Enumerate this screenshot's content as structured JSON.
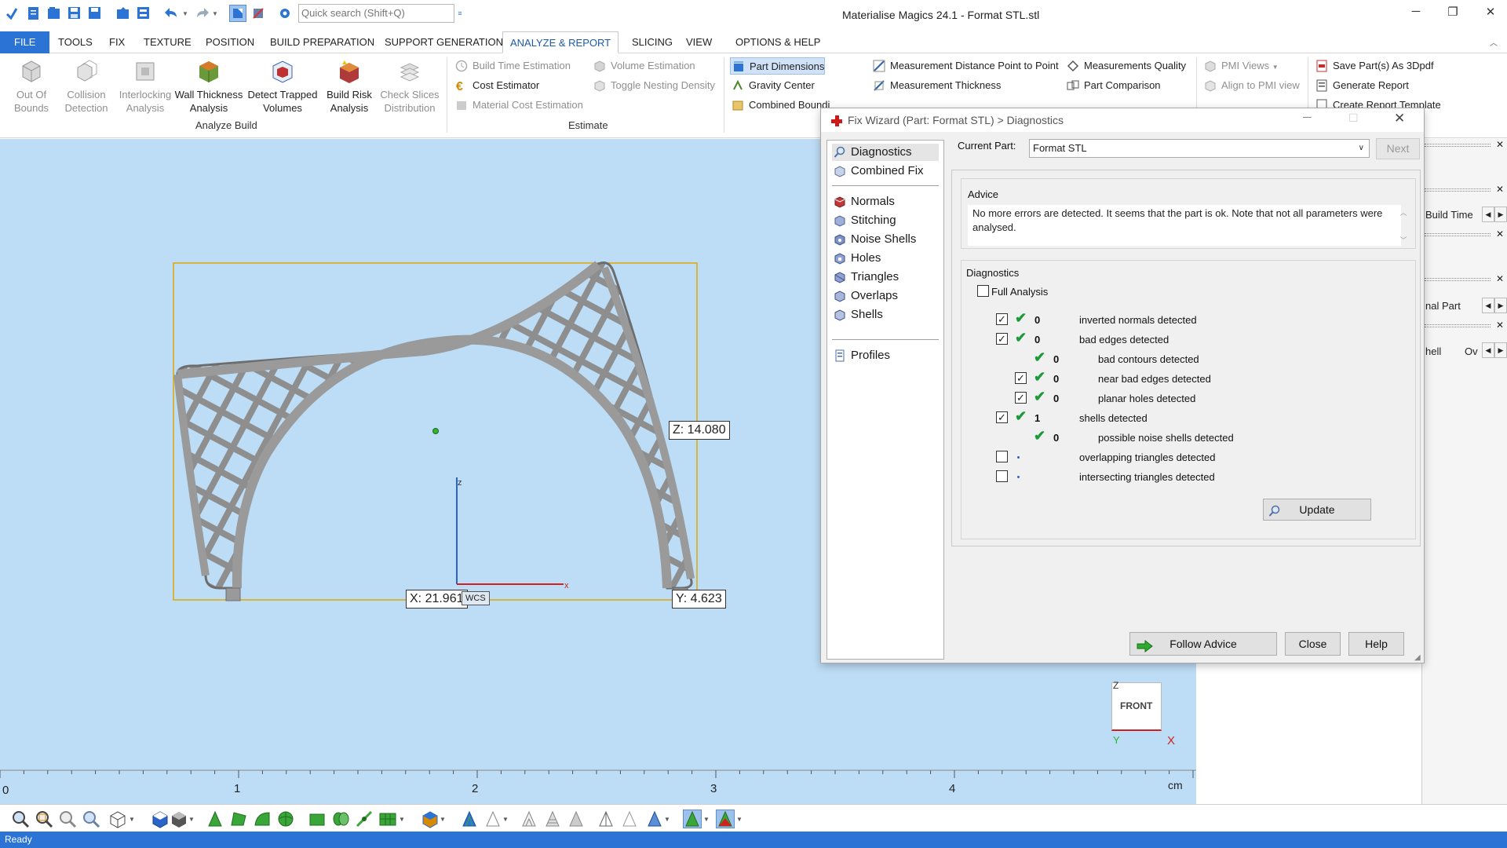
{
  "app": {
    "title": "Materialise Magics 24.1 - Format STL.stl",
    "search_placeholder": "Quick search (Shift+Q)"
  },
  "menu": {
    "items": [
      "FILE",
      "TOOLS",
      "FIX",
      "TEXTURE",
      "POSITION",
      "BUILD PREPARATION",
      "SUPPORT GENERATION",
      "ANALYZE & REPORT",
      "SLICING",
      "VIEW",
      "OPTIONS & HELP"
    ],
    "active": "ANALYZE & REPORT"
  },
  "ribbon": {
    "analyze_build": {
      "group_label": "Analyze Build",
      "out_of_bounds": [
        "Out Of",
        "Bounds"
      ],
      "collision": [
        "Collision",
        "Detection"
      ],
      "interlocking": [
        "Interlocking",
        "Analysis"
      ],
      "wall_thickness": [
        "Wall Thickness",
        "Analysis"
      ],
      "trapped": [
        "Detect Trapped",
        "Volumes"
      ],
      "build_risk": [
        "Build Risk",
        "Analysis"
      ],
      "check_slices": [
        "Check Slices",
        "Distribution"
      ]
    },
    "estimate": {
      "group_label": "Estimate",
      "build_time": "Build Time Estimation",
      "cost": "Cost Estimator",
      "material_cost": "Material Cost Estimation",
      "volume": "Volume Estimation",
      "nesting": "Toggle Nesting Density"
    },
    "measure": {
      "part_dimensions": "Part Dimensions",
      "gravity_center": "Gravity Center",
      "combined_bounding": "Combined Bounding Box",
      "distance_point": "Measurement Distance Point to Point",
      "thickness": "Measurement Thickness",
      "quality": "Measurements Quality",
      "comparison": "Part Comparison"
    },
    "pmi": {
      "pmi_views": "PMI Views",
      "align_pmi": "Align to PMI view"
    },
    "report": {
      "save_3dpdf": "Save Part(s) As 3Dpdf",
      "generate_report": "Generate Report",
      "create_template": "Create Report Template"
    }
  },
  "viewport": {
    "dim_z": "Z: 14.080",
    "dim_x": "X: 21.961",
    "dim_y": "Y: 4.623",
    "wcs": "WCS",
    "axis_z": "z",
    "axis_x": "x",
    "cube_label": "FRONT",
    "cube_z": "Z",
    "cube_y": "Y",
    "cube_x": "X",
    "ruler_ticks": [
      "0",
      "1",
      "2",
      "3",
      "4"
    ],
    "ruler_unit": "cm"
  },
  "right_panel": {
    "build_time": "Build Time",
    "original_part": "nal Part",
    "shell": "hell",
    "ov": "Ov"
  },
  "dialog": {
    "title": "Fix Wizard (Part: Format STL) > Diagnostics",
    "nav": {
      "diagnostics": "Diagnostics",
      "combined_fix": "Combined Fix",
      "normals": "Normals",
      "stitching": "Stitching",
      "noise_shells": "Noise Shells",
      "holes": "Holes",
      "triangles": "Triangles",
      "overlaps": "Overlaps",
      "shells": "Shells",
      "profiles": "Profiles"
    },
    "current_part_label": "Current Part:",
    "current_part_value": "Format STL",
    "next_button": "Next",
    "advice_title": "Advice",
    "advice_text": "No more errors are detected. It seems that the part is ok. Note that not all parameters were analysed.",
    "diagnostics_title": "Diagnostics",
    "full_analysis": "Full Analysis",
    "rows": [
      {
        "count": "0",
        "label": "inverted normals detected"
      },
      {
        "count": "0",
        "label": "bad edges detected"
      },
      {
        "count": "0",
        "label": "bad contours detected"
      },
      {
        "count": "0",
        "label": "near bad edges detected"
      },
      {
        "count": "0",
        "label": "planar holes detected"
      },
      {
        "count": "1",
        "label": "shells detected"
      },
      {
        "count": "0",
        "label": "possible noise shells detected"
      },
      {
        "count": "",
        "label": "overlapping triangles detected"
      },
      {
        "count": "",
        "label": "intersecting triangles detected"
      }
    ],
    "update_button": "Update",
    "follow_advice_button": "Follow Advice",
    "close_button": "Close",
    "help_button": "Help"
  },
  "status": {
    "text": "Ready"
  },
  "colors": {
    "accent": "#2b74d6",
    "viewport_bg": "#bdddf6",
    "part_gray": "#9a9a9a",
    "bbox": "#e0a800",
    "check_green": "#1c9a3a"
  }
}
